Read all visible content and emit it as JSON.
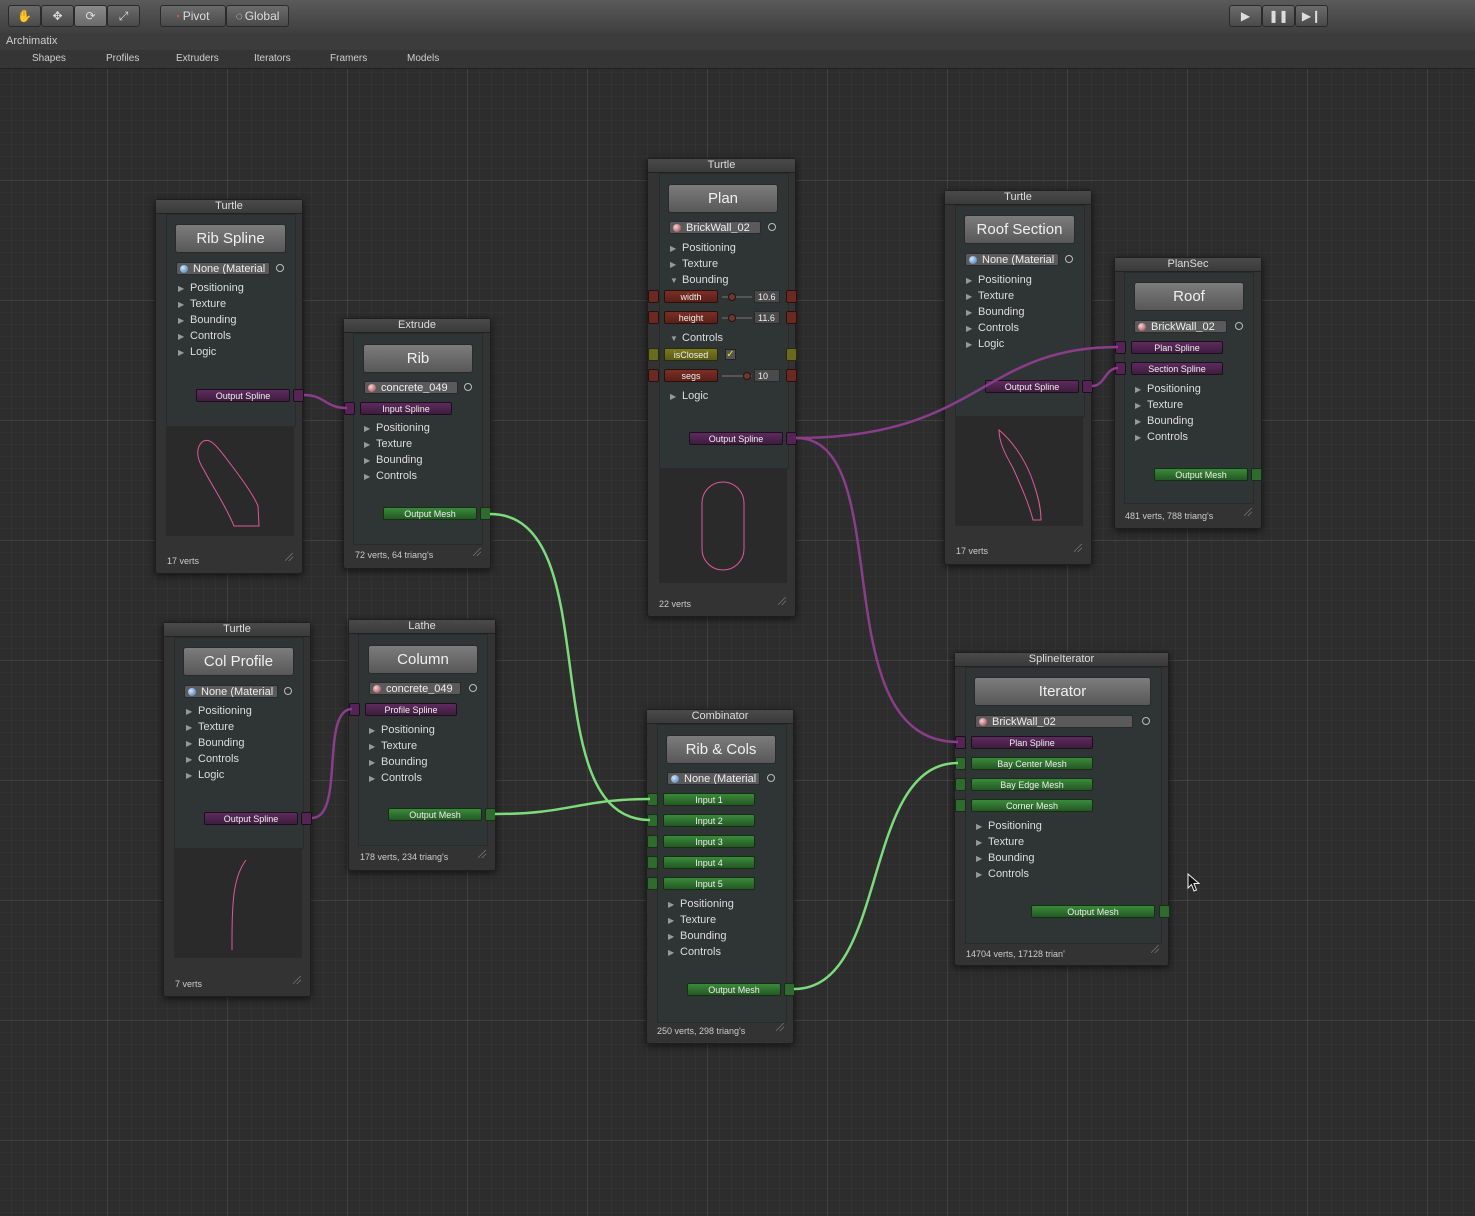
{
  "toolbar": {
    "tools": [
      "hand-tool-icon",
      "move-tool-icon",
      "rotate-tool-icon",
      "scale-tool-icon"
    ],
    "pivot_label": "Pivot",
    "global_label": "Global",
    "play": "play-icon",
    "pause": "pause-icon",
    "step": "step-icon"
  },
  "window": {
    "title": "Archimatix"
  },
  "menu": [
    "Shapes",
    "Profiles",
    "Extruders",
    "Iterators",
    "Framers",
    "Models"
  ],
  "colors": {
    "wire_purple": "#8a3d8a",
    "wire_green": "#7cdc7c",
    "spline_preview": "#e0589a",
    "accent_yellow": "#e8e800"
  },
  "nodes": {
    "rib_spline": {
      "type": "Turtle",
      "name": "Rib Spline",
      "material": "None (Material",
      "folds": [
        "Positioning",
        "Texture",
        "Bounding",
        "Controls",
        "Logic"
      ],
      "output": "Output Spline",
      "stats": "17 verts"
    },
    "rib": {
      "type": "Extrude",
      "name": "Rib",
      "material": "concrete_049",
      "input": "Input Spline",
      "folds": [
        "Positioning",
        "Texture",
        "Bounding",
        "Controls"
      ],
      "output": "Output Mesh",
      "stats": "72 verts, 64 triang's"
    },
    "plan": {
      "type": "Turtle",
      "name": "Plan",
      "material": "BrickWall_02",
      "folds": [
        "Positioning",
        "Texture",
        "Bounding"
      ],
      "params": [
        {
          "label": "width",
          "value": "10.6"
        },
        {
          "label": "height",
          "value": "11.6"
        }
      ],
      "controls_label": "Controls",
      "isclosed_label": "isClosed",
      "isclosed_value": "✓",
      "segs": {
        "label": "segs",
        "value": "10"
      },
      "logic_label": "Logic",
      "output": "Output Spline",
      "stats": "22 verts"
    },
    "roof_section": {
      "type": "Turtle",
      "name": "Roof Section",
      "material": "None (Material",
      "folds": [
        "Positioning",
        "Texture",
        "Bounding",
        "Controls",
        "Logic"
      ],
      "output": "Output Spline",
      "stats": "17 verts"
    },
    "roof": {
      "type": "PlanSec",
      "name": "Roof",
      "material": "BrickWall_02",
      "inputs": [
        "Plan Spline",
        "Section Spline"
      ],
      "folds": [
        "Positioning",
        "Texture",
        "Bounding",
        "Controls"
      ],
      "output": "Output Mesh",
      "stats": "481 verts, 788 triang's"
    },
    "col_profile": {
      "type": "Turtle",
      "name": "Col Profile",
      "material": "None (Material",
      "folds": [
        "Positioning",
        "Texture",
        "Bounding",
        "Controls",
        "Logic"
      ],
      "output": "Output Spline",
      "stats": "7 verts"
    },
    "column": {
      "type": "Lathe",
      "name": "Column",
      "material": "concrete_049",
      "input": "Profile Spline",
      "folds": [
        "Positioning",
        "Texture",
        "Bounding",
        "Controls"
      ],
      "output": "Output Mesh",
      "stats": "178 verts, 234 triang's"
    },
    "rib_cols": {
      "type": "Combinator",
      "name": "Rib & Cols",
      "material": "None (Material",
      "inputs": [
        "Input 1",
        "Input 2",
        "Input 3",
        "Input 4",
        "Input 5"
      ],
      "folds": [
        "Positioning",
        "Texture",
        "Bounding",
        "Controls"
      ],
      "output": "Output Mesh",
      "stats": "250 verts, 298 triang's"
    },
    "iterator": {
      "type": "SplineIterator",
      "name": "Iterator",
      "material": "BrickWall_02",
      "inputs": [
        "Plan Spline",
        "Bay Center Mesh",
        "Bay Edge Mesh",
        "Corner Mesh"
      ],
      "folds": [
        "Positioning",
        "Texture",
        "Bounding",
        "Controls"
      ],
      "output": "Output Mesh",
      "stats": "14704 verts, 17128 trian'"
    }
  }
}
